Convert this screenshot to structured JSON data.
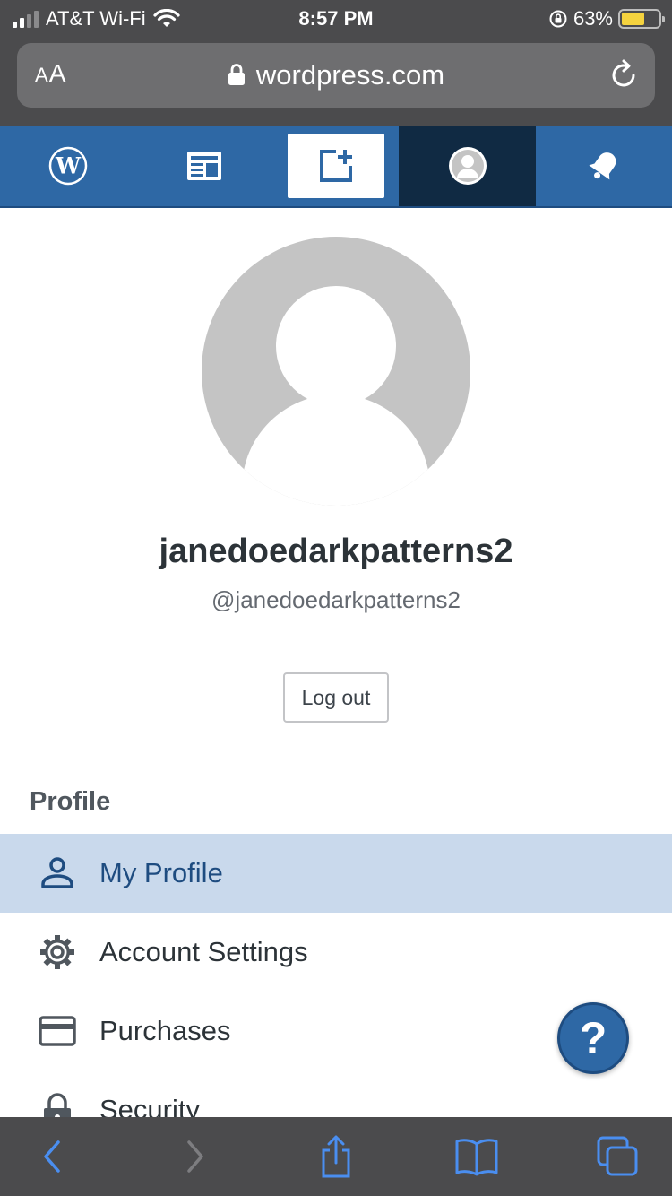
{
  "status_bar": {
    "carrier": "AT&T Wi-Fi",
    "time": "8:57 PM",
    "battery_percent": "63%",
    "battery_level": 0.63
  },
  "browser": {
    "text_size_label_small": "A",
    "text_size_label_large": "A",
    "url": "wordpress.com"
  },
  "masterbar": {
    "items": [
      {
        "icon": "wordpress-logo-icon"
      },
      {
        "icon": "reader-icon"
      },
      {
        "icon": "write-post-icon"
      },
      {
        "icon": "me-avatar-icon",
        "active": true
      },
      {
        "icon": "notifications-bell-icon"
      }
    ],
    "colors": {
      "bar": "#2e68a5",
      "active": "#102a43"
    }
  },
  "profile": {
    "display_name": "janedoedarkpatterns2",
    "username": "@janedoedarkpatterns2",
    "logout_label": "Log out"
  },
  "menu": {
    "section_title": "Profile",
    "items": [
      {
        "label": "My Profile",
        "icon": "person-icon",
        "selected": true
      },
      {
        "label": "Account Settings",
        "icon": "gear-icon"
      },
      {
        "label": "Purchases",
        "icon": "credit-card-icon"
      },
      {
        "label": "Security",
        "icon": "lock-icon"
      }
    ]
  },
  "help": {
    "label": "?"
  },
  "toolbar": {
    "items": [
      "back-icon",
      "forward-icon",
      "share-icon",
      "bookmarks-icon",
      "tabs-icon"
    ]
  }
}
